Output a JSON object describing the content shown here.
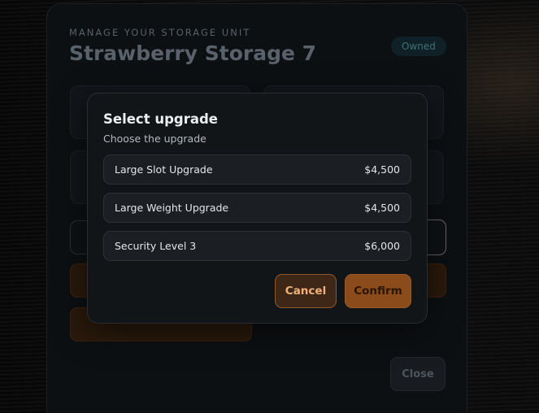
{
  "background_panel": {
    "kicker": "MANAGE YOUR STORAGE UNIT",
    "title": "Strawberry Storage 7",
    "badge": "Owned",
    "close_label": "Close"
  },
  "modal": {
    "title": "Select upgrade",
    "subtitle": "Choose the upgrade",
    "options": [
      {
        "name": "Large Slot Upgrade",
        "price": "$4,500"
      },
      {
        "name": "Large Weight Upgrade",
        "price": "$4,500"
      },
      {
        "name": "Security Level 3",
        "price": "$6,000"
      }
    ],
    "cancel_label": "Cancel",
    "confirm_label": "Confirm"
  },
  "colors": {
    "accent": "#8b4b1b",
    "cancel_text": "#f0b27a",
    "badge_text": "#3f6f7a"
  }
}
